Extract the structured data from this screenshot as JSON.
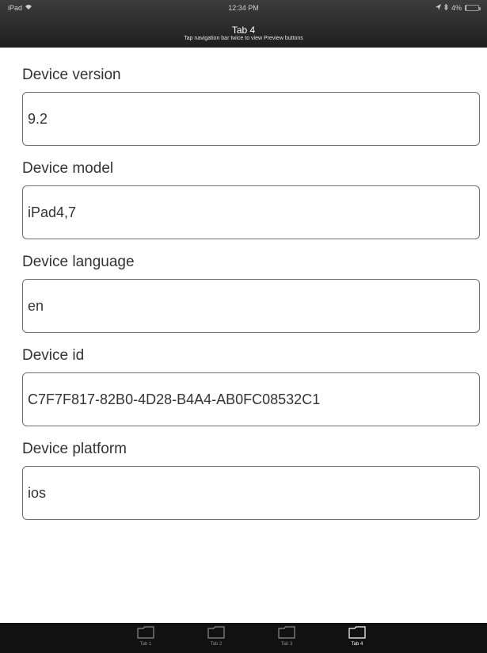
{
  "status_bar": {
    "carrier": "iPad",
    "time": "12:34 PM",
    "battery": "4%",
    "battery_level": 0.04
  },
  "nav_bar": {
    "title": "Tab 4",
    "subtitle": "Tap navigation bar twice to view Preview buttons"
  },
  "form": {
    "fields": [
      {
        "label": "Device version",
        "value": "9.2"
      },
      {
        "label": "Device model",
        "value": "iPad4,7"
      },
      {
        "label": "Device language",
        "value": "en"
      },
      {
        "label": "Device id",
        "value": "C7F7F817-82B0-4D28-B4A4-AB0FC08532C1"
      },
      {
        "label": "Device platform",
        "value": "ios"
      }
    ]
  },
  "tab_bar": {
    "tabs": [
      {
        "label": "Tab 1",
        "icon": "folder-icon",
        "active": false
      },
      {
        "label": "Tab 2",
        "icon": "folder-icon",
        "active": false
      },
      {
        "label": "Tab 3",
        "icon": "folder-icon",
        "active": false
      },
      {
        "label": "Tab 4",
        "icon": "folder-icon",
        "active": true
      }
    ]
  },
  "colors": {
    "nav_bar": "#2a2a2a",
    "tab_bar": "#111111",
    "field_border": "#6f6f6f",
    "text": "#333333"
  }
}
